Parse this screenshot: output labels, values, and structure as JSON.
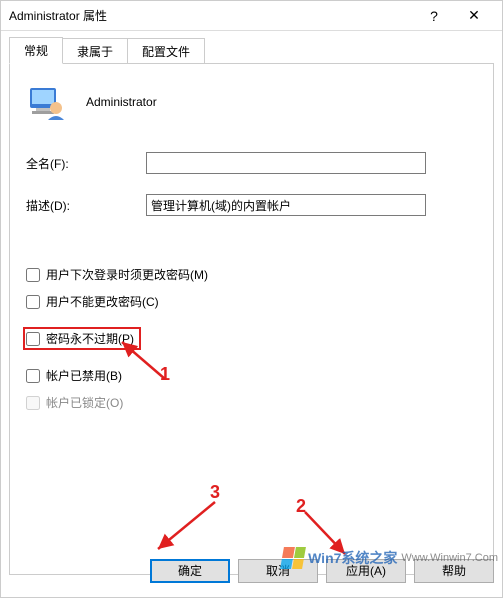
{
  "window": {
    "title": "Administrator 属性",
    "help_tooltip": "?",
    "close_tooltip": "✕"
  },
  "tabs": [
    {
      "label": "常规",
      "active": true
    },
    {
      "label": "隶属于",
      "active": false
    },
    {
      "label": "配置文件",
      "active": false
    }
  ],
  "user": {
    "name": "Administrator"
  },
  "fields": {
    "fullname_label": "全名(F):",
    "fullname_value": "",
    "description_label": "描述(D):",
    "description_value": "管理计算机(域)的内置帐户"
  },
  "checkboxes": {
    "mustchange": {
      "label": "用户下次登录时须更改密码(M)",
      "checked": false,
      "disabled": false
    },
    "cannotchange": {
      "label": "用户不能更改密码(C)",
      "checked": false,
      "disabled": false
    },
    "neverexpire": {
      "label": "密码永不过期(P)",
      "checked": false,
      "disabled": false
    },
    "disabled": {
      "label": "帐户已禁用(B)",
      "checked": false,
      "disabled": false
    },
    "locked": {
      "label": "帐户已锁定(O)",
      "checked": false,
      "disabled": true
    }
  },
  "annotations": {
    "mark1": "1",
    "mark2": "2",
    "mark3": "3"
  },
  "buttons": {
    "ok": "确定",
    "cancel": "取消",
    "apply": "应用(A)",
    "help": "帮助"
  },
  "watermark": {
    "brand": "Win7系统之家",
    "url": "Www.Winwin7.Com"
  }
}
